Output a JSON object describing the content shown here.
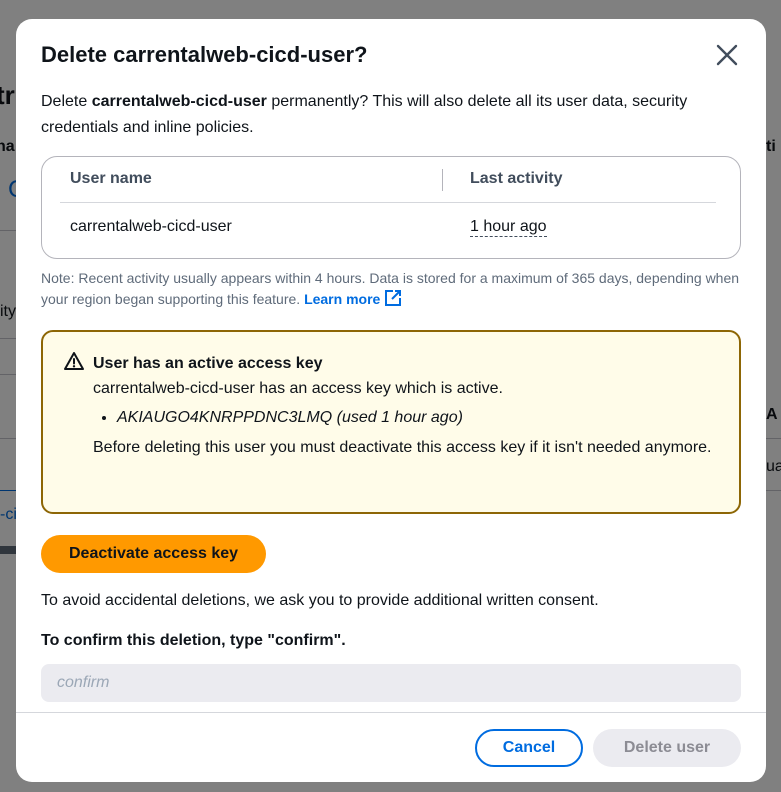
{
  "modal": {
    "title": "Delete carrentalweb-cicd-user?",
    "intro_prefix": "Delete ",
    "intro_user": "carrentalweb-cicd-user",
    "intro_suffix": " permanently? This will also delete all its user data, security credentials and inline policies.",
    "table": {
      "headers": [
        "User name",
        "Last activity"
      ],
      "rows": [
        {
          "user_name": "carrentalweb-cicd-user",
          "last_activity": "1 hour ago"
        }
      ]
    },
    "note": "Note: Recent activity usually appears within 4 hours. Data is stored for a maximum of 365 days, depending when your region began supporting this feature.",
    "learn_more": "Learn more",
    "warning": {
      "title": "User has an active access key",
      "text": "carrentalweb-cicd-user has an access key which is active.",
      "keys": [
        "AKIAUGO4KNRPPDNC3LMQ (used 1 hour ago)"
      ],
      "footer": "Before deleting this user you must deactivate this access key if it isn't needed anymore."
    },
    "deactivate_button": "Deactivate access key",
    "consent_text": "To avoid accidental deletions, we ask you to provide additional written consent.",
    "confirm_label": "To confirm this deletion, type \"confirm\".",
    "confirm_placeholder": "confirm",
    "cancel_button": "Cancel",
    "delete_button": "Delete user"
  },
  "colors": {
    "accent": "#006ce0",
    "primary_button": "#ff9900",
    "warning_border": "#8d6605",
    "warning_bg": "#fffce9"
  }
}
